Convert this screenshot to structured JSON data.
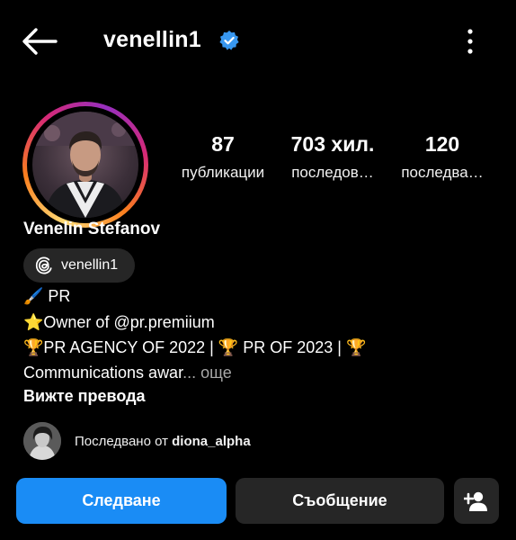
{
  "header": {
    "username": "venellin1",
    "verified": true
  },
  "stats": [
    {
      "value": "87",
      "label": "публикации"
    },
    {
      "value": "703 хил.",
      "label": "последов…"
    },
    {
      "value": "120",
      "label": "последва…"
    }
  ],
  "profile": {
    "full_name": "Venelin Stefanov",
    "threads_handle": "venellin1"
  },
  "bio": {
    "lines": [
      "🖌️ PR",
      "⭐Owner of @pr.premiium",
      "🏆PR AGENCY OF 2022 | 🏆 PR OF 2023 | 🏆",
      "Communications awar"
    ],
    "more": "... още",
    "translate": "Вижте превода"
  },
  "followed_by": {
    "prefix": "Последвано от ",
    "user": "diona_alpha"
  },
  "actions": {
    "follow": "Следване",
    "message": "Съобщение"
  },
  "colors": {
    "background": "#000000",
    "follow_button": "#1a8cf5",
    "secondary_button": "#262626",
    "verified_badge": "#3897f0"
  }
}
